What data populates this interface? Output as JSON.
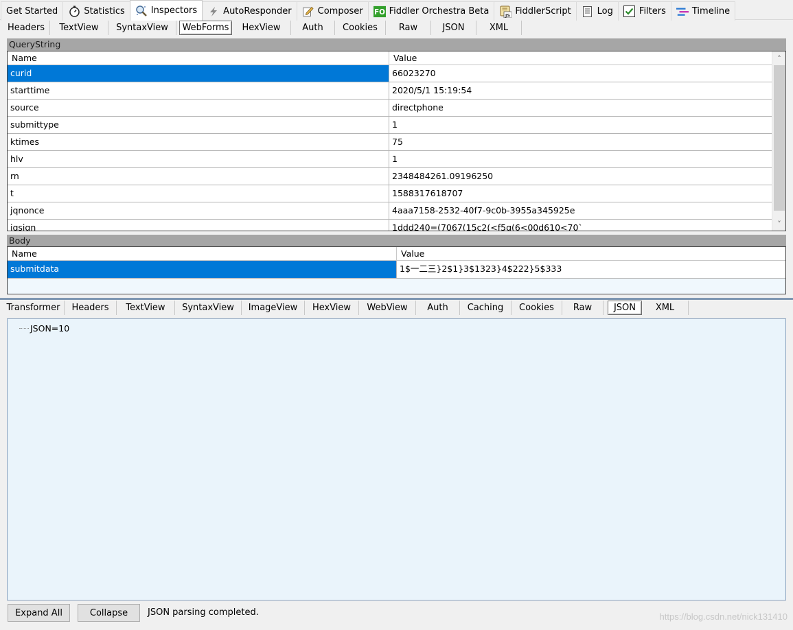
{
  "top_tabs": [
    {
      "label": "Get Started",
      "icon": "none"
    },
    {
      "label": "Statistics",
      "icon": "stopwatch-icon"
    },
    {
      "label": "Inspectors",
      "icon": "magnifier-icon",
      "active": true
    },
    {
      "label": "AutoResponder",
      "icon": "lightning-icon"
    },
    {
      "label": "Composer",
      "icon": "pencil-icon"
    },
    {
      "label": "Fiddler Orchestra Beta",
      "icon": "fo-icon",
      "icon_text": "FO"
    },
    {
      "label": "FiddlerScript",
      "icon": "script-icon",
      "icon_text": "JS"
    },
    {
      "label": "Log",
      "icon": "document-icon"
    },
    {
      "label": "Filters",
      "icon": "checkbox-icon"
    },
    {
      "label": "Timeline",
      "icon": "timeline-icon"
    }
  ],
  "request_tabs": [
    {
      "label": "Headers"
    },
    {
      "label": "TextView"
    },
    {
      "label": "SyntaxView"
    },
    {
      "label": "WebForms",
      "active": true
    },
    {
      "label": "HexView"
    },
    {
      "label": "Auth"
    },
    {
      "label": "Cookies"
    },
    {
      "label": "Raw"
    },
    {
      "label": "JSON"
    },
    {
      "label": "XML"
    }
  ],
  "querystring": {
    "title": "QueryString",
    "col_name": "Name",
    "col_value": "Value",
    "rows": [
      {
        "name": "curid",
        "value": "66023270",
        "selected": true
      },
      {
        "name": "starttime",
        "value": "2020/5/1 15:19:54"
      },
      {
        "name": "source",
        "value": "directphone"
      },
      {
        "name": "submittype",
        "value": "1"
      },
      {
        "name": "ktimes",
        "value": "75"
      },
      {
        "name": "hlv",
        "value": "1"
      },
      {
        "name": "rn",
        "value": "2348484261.09196250"
      },
      {
        "name": "t",
        "value": "1588317618707"
      },
      {
        "name": "jqnonce",
        "value": "4aaa7158-2532-40f7-9c0b-3955a345925e"
      },
      {
        "name": "jqsign",
        "value": "1ddd240=(7067(15c2(<f5g(6<00d610<70`"
      }
    ]
  },
  "body": {
    "title": "Body",
    "col_name": "Name",
    "col_value": "Value",
    "rows": [
      {
        "name": "submitdata",
        "value": "1$一二三}2$1}3$1323}4$222}5$333",
        "selected": true
      }
    ]
  },
  "response_tabs": [
    {
      "label": "Transformer"
    },
    {
      "label": "Headers"
    },
    {
      "label": "TextView"
    },
    {
      "label": "SyntaxView"
    },
    {
      "label": "ImageView"
    },
    {
      "label": "HexView"
    },
    {
      "label": "WebView"
    },
    {
      "label": "Auth"
    },
    {
      "label": "Caching"
    },
    {
      "label": "Cookies"
    },
    {
      "label": "Raw"
    },
    {
      "label": "JSON",
      "active": true
    },
    {
      "label": "XML"
    }
  ],
  "json_tree": {
    "node": "JSON=10"
  },
  "buttons": {
    "expand_all": "Expand All",
    "collapse": "Collapse"
  },
  "status": "JSON parsing completed.",
  "watermark": "https://blog.csdn.net/nick131410",
  "colors": {
    "selection": "#0078d7",
    "json_bg": "#eaf4fb",
    "group_header": "#a6a6a6"
  }
}
